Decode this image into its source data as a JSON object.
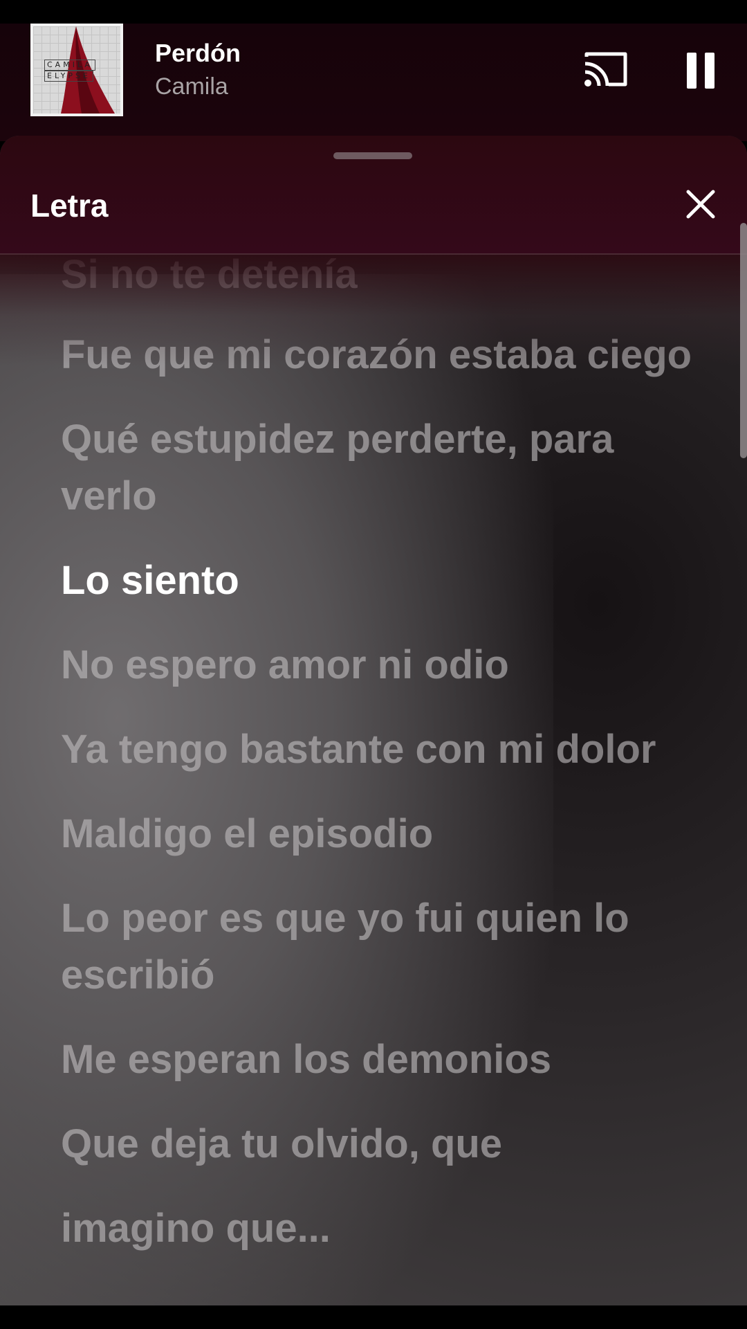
{
  "now_playing": {
    "title": "Perdón",
    "artist": "Camila",
    "album_art_text_line1": "CAMILA",
    "album_art_text_line2": "ELYPSE"
  },
  "lyrics_sheet": {
    "title": "Letra",
    "lines": [
      "Si no te detenía",
      "Fue que mi corazón estaba ciego",
      "Qué estupidez perderte, para verlo",
      "Lo siento",
      "No espero amor ni odio",
      "Ya tengo bastante con mi dolor",
      "Maldigo el episodio",
      "Lo peor es que yo fui quien lo escribió",
      "Me esperan los demonios",
      "Que deja tu olvido, que",
      "imagino que..."
    ],
    "active_line": "Lo siento"
  },
  "icons": {
    "cast": "cast-icon",
    "pause": "pause-icon",
    "close": "close-icon"
  }
}
